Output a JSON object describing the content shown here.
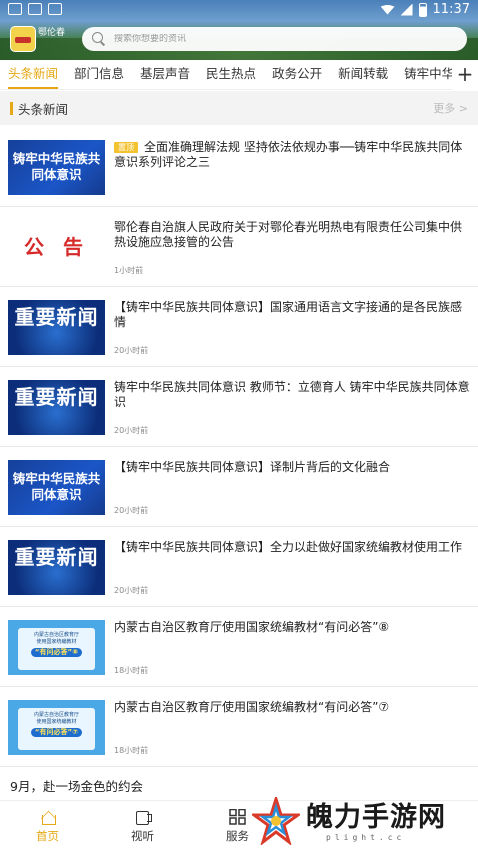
{
  "status_bar": {
    "time": "11:37"
  },
  "app": {
    "logo_text": "鄂伦春"
  },
  "search": {
    "placeholder": "搜索你想要的资讯"
  },
  "tabs": [
    "头条新闻",
    "部门信息",
    "基层声音",
    "民生热点",
    "政务公开",
    "新闻转载",
    "铸牢中华"
  ],
  "section": {
    "title": "头条新闻",
    "more": "更多 >"
  },
  "news": [
    {
      "badge": "置顶",
      "title": "全面准确理解法规 坚持依法依规办事──铸牢中华民族共同体意识系列评论之三",
      "time": "",
      "thumb_text": "铸牢中华民族共同体意识"
    },
    {
      "title": "鄂伦春自治旗人民政府关于对鄂伦春光明热电有限责任公司集中供热设施应急接管的公告",
      "time": "1小时前",
      "thumb_text": "公 告"
    },
    {
      "title": "【铸牢中华民族共同体意识】国家通用语言文字接通的是各民族感情",
      "time": "20小时前",
      "thumb_text": "重要新闻"
    },
    {
      "title": "铸牢中华民族共同体意识 教师节：立德育人 铸牢中华民族共同体意识",
      "time": "20小时前",
      "thumb_text": "重要新闻"
    },
    {
      "title": "【铸牢中华民族共同体意识】译制片背后的文化融合",
      "time": "20小时前",
      "thumb_text": "铸牢中华民族共同体意识"
    },
    {
      "title": "【铸牢中华民族共同体意识】全力以赴做好国家统编教材使用工作",
      "time": "20小时前",
      "thumb_text": "重要新闻"
    },
    {
      "title": "内蒙古自治区教育厅使用国家统编教材“有问必答”⑧",
      "time": "18小时前",
      "thumb_line1": "内蒙古自治区教育厅",
      "thumb_line2": "使用国家统编教材",
      "thumb_pill": "“有问必答”⑧"
    },
    {
      "title": "内蒙古自治区教育厅使用国家统编教材“有问必答”⑦",
      "time": "18小时前",
      "thumb_line1": "内蒙古自治区教育厅",
      "thumb_line2": "使用国家统编教材",
      "thumb_pill": "“有问必答”⑦"
    }
  ],
  "text_item": {
    "title": "9月，赴一场金色的约会",
    "time": ""
  },
  "bottom_nav": [
    {
      "label": "首页",
      "icon": "home-icon"
    },
    {
      "label": "视听",
      "icon": "video-icon"
    },
    {
      "label": "服务",
      "icon": "grid-icon"
    }
  ],
  "watermark": {
    "text": "魄力手游网",
    "sub": "plight.cc"
  },
  "colors": {
    "accent": "#e6a817",
    "badge": "#f2c230"
  }
}
